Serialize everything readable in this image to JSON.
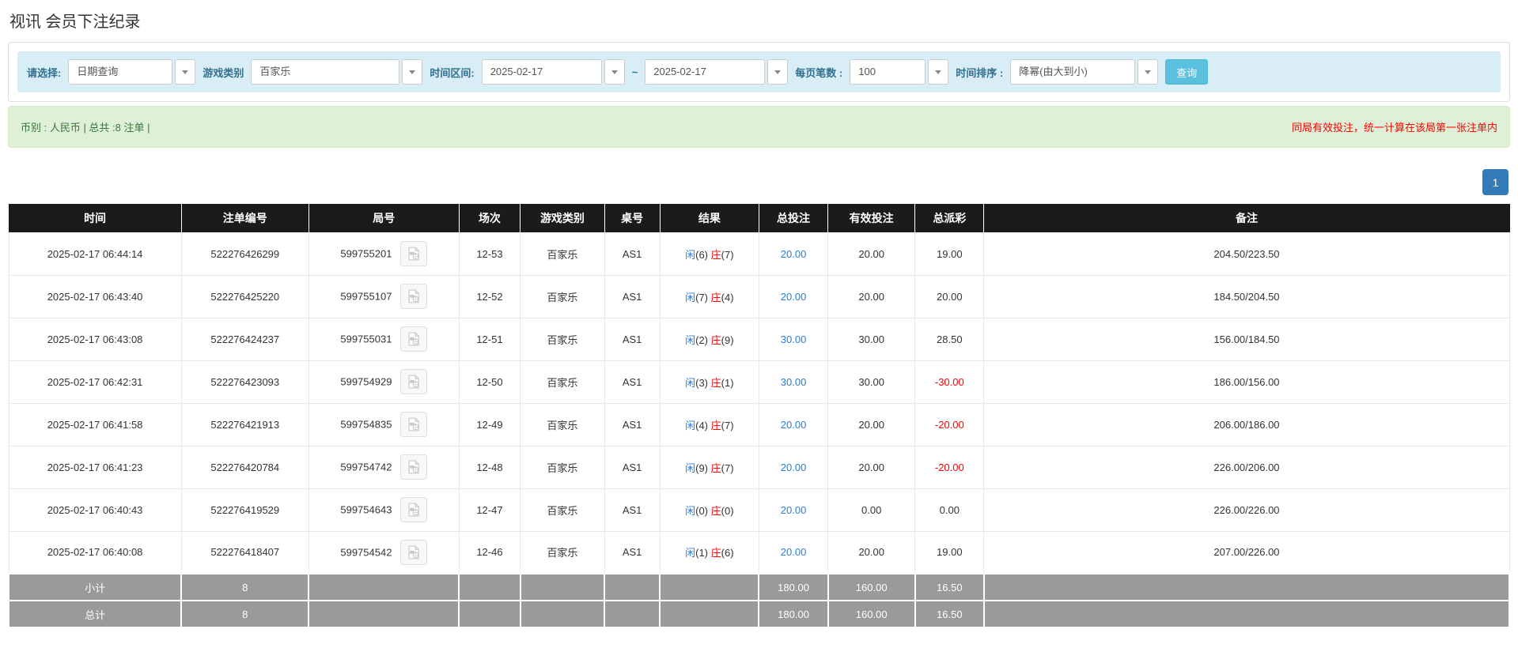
{
  "page": {
    "title": "视讯 会员下注纪录"
  },
  "filters": {
    "select_label": "请选择:",
    "select_value": "日期查询",
    "game_type_label": "游戏类别",
    "game_type_value": "百家乐",
    "time_range_label": "时间区间:",
    "date_from": "2025-02-17",
    "range_separator": "~",
    "date_to": "2025-02-17",
    "page_size_label": "每页笔数 :",
    "page_size_value": "100",
    "sort_label": "时间排序 :",
    "sort_value": "降幂(由大到小)",
    "search_button": "查询"
  },
  "summary": {
    "left_text": "币别 : 人民币 | 总共 :8 注单 |",
    "right_note": "同局有效投注，统一计算在该局第一张注单内"
  },
  "pagination": {
    "current_page": "1"
  },
  "table": {
    "columns": [
      "时间",
      "注单编号",
      "局号",
      "场次",
      "游戏类别",
      "桌号",
      "结果",
      "总投注",
      "有效投注",
      "总派彩",
      "备注"
    ],
    "rows": [
      {
        "time": "2025-02-17 06:44:14",
        "bet_no": "522276426299",
        "round_no": "599755201",
        "session": "12-53",
        "game": "百家乐",
        "table_no": "AS1",
        "result": {
          "player": "闲",
          "player_score": "(6)",
          "banker": "庄",
          "banker_score": "(7)"
        },
        "total_bet": "20.00",
        "valid_bet": "20.00",
        "payout": "19.00",
        "payout_negative": false,
        "remark": "204.50/223.50"
      },
      {
        "time": "2025-02-17 06:43:40",
        "bet_no": "522276425220",
        "round_no": "599755107",
        "session": "12-52",
        "game": "百家乐",
        "table_no": "AS1",
        "result": {
          "player": "闲",
          "player_score": "(7)",
          "banker": "庄",
          "banker_score": "(4)"
        },
        "total_bet": "20.00",
        "valid_bet": "20.00",
        "payout": "20.00",
        "payout_negative": false,
        "remark": "184.50/204.50"
      },
      {
        "time": "2025-02-17 06:43:08",
        "bet_no": "522276424237",
        "round_no": "599755031",
        "session": "12-51",
        "game": "百家乐",
        "table_no": "AS1",
        "result": {
          "player": "闲",
          "player_score": "(2)",
          "banker": "庄",
          "banker_score": "(9)"
        },
        "total_bet": "30.00",
        "valid_bet": "30.00",
        "payout": "28.50",
        "payout_negative": false,
        "remark": "156.00/184.50"
      },
      {
        "time": "2025-02-17 06:42:31",
        "bet_no": "522276423093",
        "round_no": "599754929",
        "session": "12-50",
        "game": "百家乐",
        "table_no": "AS1",
        "result": {
          "player": "闲",
          "player_score": "(3)",
          "banker": "庄",
          "banker_score": "(1)"
        },
        "total_bet": "30.00",
        "valid_bet": "30.00",
        "payout": "-30.00",
        "payout_negative": true,
        "remark": "186.00/156.00"
      },
      {
        "time": "2025-02-17 06:41:58",
        "bet_no": "522276421913",
        "round_no": "599754835",
        "session": "12-49",
        "game": "百家乐",
        "table_no": "AS1",
        "result": {
          "player": "闲",
          "player_score": "(4)",
          "banker": "庄",
          "banker_score": "(7)"
        },
        "total_bet": "20.00",
        "valid_bet": "20.00",
        "payout": "-20.00",
        "payout_negative": true,
        "remark": "206.00/186.00"
      },
      {
        "time": "2025-02-17 06:41:23",
        "bet_no": "522276420784",
        "round_no": "599754742",
        "session": "12-48",
        "game": "百家乐",
        "table_no": "AS1",
        "result": {
          "player": "闲",
          "player_score": "(9)",
          "banker": "庄",
          "banker_score": "(7)"
        },
        "total_bet": "20.00",
        "valid_bet": "20.00",
        "payout": "-20.00",
        "payout_negative": true,
        "remark": "226.00/206.00"
      },
      {
        "time": "2025-02-17 06:40:43",
        "bet_no": "522276419529",
        "round_no": "599754643",
        "session": "12-47",
        "game": "百家乐",
        "table_no": "AS1",
        "result": {
          "player": "闲",
          "player_score": "(0)",
          "banker": "庄",
          "banker_score": "(0)"
        },
        "total_bet": "20.00",
        "valid_bet": "0.00",
        "payout": "0.00",
        "payout_negative": false,
        "remark": "226.00/226.00"
      },
      {
        "time": "2025-02-17 06:40:08",
        "bet_no": "522276418407",
        "round_no": "599754542",
        "session": "12-46",
        "game": "百家乐",
        "table_no": "AS1",
        "result": {
          "player": "闲",
          "player_score": "(1)",
          "banker": "庄",
          "banker_score": "(6)"
        },
        "total_bet": "20.00",
        "valid_bet": "20.00",
        "payout": "19.00",
        "payout_negative": false,
        "remark": "207.00/226.00"
      }
    ],
    "footer": [
      {
        "label": "小计",
        "count": "8",
        "total_bet": "180.00",
        "valid_bet": "160.00",
        "payout": "16.50"
      },
      {
        "label": "总计",
        "count": "8",
        "total_bet": "180.00",
        "valid_bet": "160.00",
        "payout": "16.50"
      }
    ]
  },
  "colors": {
    "accent_blue": "#337ab7",
    "link_blue": "#2b7cd3",
    "negative_red": "#ff0000",
    "header_bg": "#1b1b1b",
    "footer_bg": "#9a9a9a",
    "filter_bar_bg": "#d9edf7",
    "alert_bg": "#dff0d8",
    "search_button_bg": "#5bc0de"
  }
}
